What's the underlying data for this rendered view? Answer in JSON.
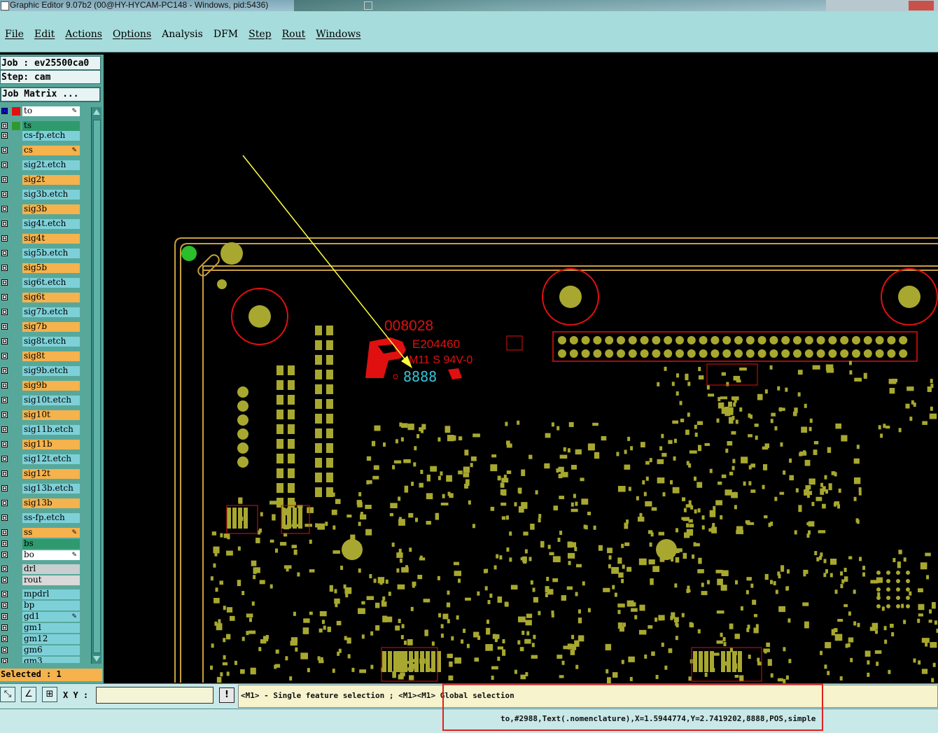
{
  "window": {
    "title": "Graphic Editor 9.07b2 (00@HY-HYCAM-PC148 - Windows, pid:5436)"
  },
  "menu": [
    "File",
    "Edit",
    "Actions",
    "Options",
    "Analysis",
    "DFM",
    "Step",
    "Rout",
    "Windows"
  ],
  "job": {
    "job_line": "Job : ev25500ca0",
    "step_line": "Step: cam",
    "matrix_label": "Job Matrix ..."
  },
  "layers": [
    {
      "name": "to",
      "color": "#ffffff",
      "edit": true
    },
    {
      "name": "ts",
      "color": "#2e9a6e",
      "edit": false
    },
    {
      "name": "cs-fp.etch",
      "color": "#7ed0d8",
      "edit": false
    },
    {
      "name": "cs",
      "color": "#f5b24d",
      "edit": true
    },
    {
      "name": "sig2t.etch",
      "color": "#7ed0d8",
      "edit": false
    },
    {
      "name": "sig2t",
      "color": "#f5b24d",
      "edit": false
    },
    {
      "name": "sig3b.etch",
      "color": "#7ed0d8",
      "edit": false
    },
    {
      "name": "sig3b",
      "color": "#f5b24d",
      "edit": false
    },
    {
      "name": "sig4t.etch",
      "color": "#7ed0d8",
      "edit": false
    },
    {
      "name": "sig4t",
      "color": "#f5b24d",
      "edit": false
    },
    {
      "name": "sig5b.etch",
      "color": "#7ed0d8",
      "edit": false
    },
    {
      "name": "sig5b",
      "color": "#f5b24d",
      "edit": false
    },
    {
      "name": "sig6t.etch",
      "color": "#7ed0d8",
      "edit": false
    },
    {
      "name": "sig6t",
      "color": "#f5b24d",
      "edit": false
    },
    {
      "name": "sig7b.etch",
      "color": "#7ed0d8",
      "edit": false
    },
    {
      "name": "sig7b",
      "color": "#f5b24d",
      "edit": false
    },
    {
      "name": "sig8t.etch",
      "color": "#7ed0d8",
      "edit": false
    },
    {
      "name": "sig8t",
      "color": "#f5b24d",
      "edit": false
    },
    {
      "name": "sig9b.etch",
      "color": "#7ed0d8",
      "edit": false
    },
    {
      "name": "sig9b",
      "color": "#f5b24d",
      "edit": false
    },
    {
      "name": "sig10t.etch",
      "color": "#7ed0d8",
      "edit": false
    },
    {
      "name": "sig10t",
      "color": "#f5b24d",
      "edit": false
    },
    {
      "name": "sig11b.etch",
      "color": "#7ed0d8",
      "edit": false
    },
    {
      "name": "sig11b",
      "color": "#f5b24d",
      "edit": false
    },
    {
      "name": "sig12t.etch",
      "color": "#7ed0d8",
      "edit": false
    },
    {
      "name": "sig12t",
      "color": "#f5b24d",
      "edit": false
    },
    {
      "name": "sig13b.etch",
      "color": "#7ed0d8",
      "edit": false
    },
    {
      "name": "sig13b",
      "color": "#f5b24d",
      "edit": false
    },
    {
      "name": "ss-fp.etch",
      "color": "#7ed0d8",
      "edit": false
    },
    {
      "name": "ss",
      "color": "#f5b24d",
      "edit": true
    },
    {
      "name": "bs",
      "color": "#2e9a6e",
      "edit": false
    },
    {
      "name": "bo",
      "color": "#ffffff",
      "edit": true
    },
    {
      "name": "drl",
      "color": "#c9cfcf",
      "edit": false
    },
    {
      "name": "rout",
      "color": "#d9d9d9",
      "edit": false
    },
    {
      "name": "mpdrl",
      "color": "#7ed0d8",
      "edit": false
    },
    {
      "name": "bp",
      "color": "#7ed0d8",
      "edit": false
    },
    {
      "name": "gd1",
      "color": "#7ed0d8",
      "edit": true
    },
    {
      "name": "gm1",
      "color": "#7ed0d8",
      "edit": false
    },
    {
      "name": "gm12",
      "color": "#7ed0d8",
      "edit": false
    },
    {
      "name": "gm6",
      "color": "#7ed0d8",
      "edit": false
    },
    {
      "name": "gm3",
      "color": "#7ed0d8",
      "edit": false
    }
  ],
  "selected": "Selected : 1",
  "toolbar": {
    "xy_label": "X Y :",
    "xy_value": "",
    "excl": "!"
  },
  "hint": "<M1> - Single feature selection ; <M1><M1> Global selection",
  "status": "to,#2988,Text(.nomenclature),X=1.5944774,Y=2.7419202,8888,POS,simple",
  "board": {
    "marking_1": "008028",
    "marking_2": "E204460",
    "marking_3": "M11 S 94V-0",
    "selected_text": "8888"
  },
  "colors": {
    "pad": "#a8a830",
    "outline": "#c8a040",
    "silk": "#e01010",
    "highlight": "#33c3d6",
    "arrow": "#ffff40"
  }
}
